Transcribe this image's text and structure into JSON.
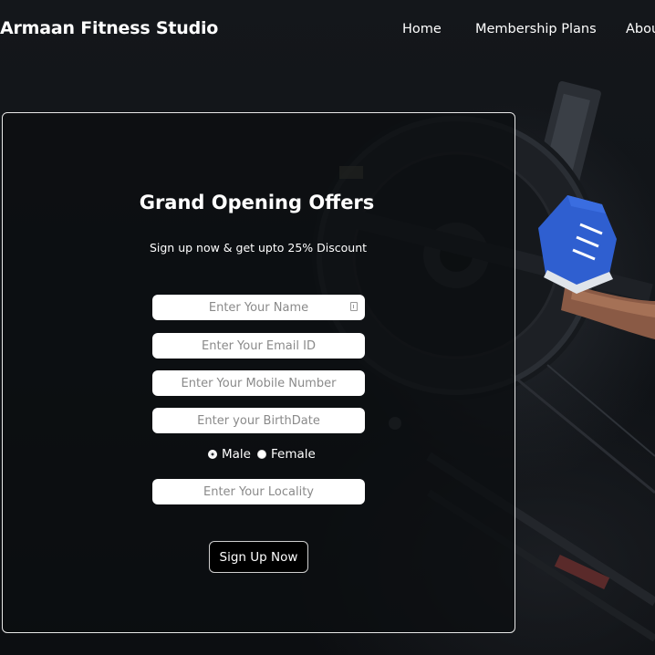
{
  "header": {
    "brand": "Armaan Fitness Studio",
    "nav": {
      "home": "Home",
      "plans": "Membership Plans",
      "about": "About"
    }
  },
  "offer_form": {
    "title": "Grand Opening Offers",
    "subtitle": "Sign up now & get upto 25% Discount",
    "fields": {
      "name_placeholder": "Enter Your Name",
      "email_placeholder": "Enter Your Email ID",
      "mobile_placeholder": "Enter Your Mobile Number",
      "birthdate_placeholder": "Enter your BirthDate",
      "locality_placeholder": "Enter Your Locality"
    },
    "gender": {
      "male_label": "Male",
      "female_label": "Female",
      "selected": "Male"
    },
    "submit_label": "Sign Up Now"
  },
  "colors": {
    "background": "#0f1216",
    "accent_shoe": "#2f5fd0",
    "button_bg": "#000000",
    "text": "#ffffff"
  }
}
